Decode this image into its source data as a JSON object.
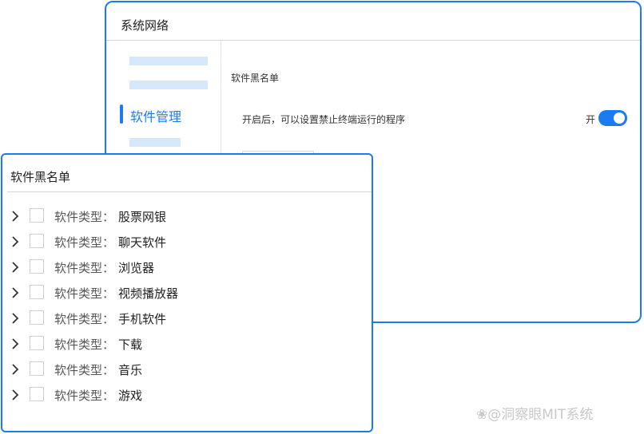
{
  "back_window": {
    "title": "系统网络",
    "sidebar_active_item": "软件管理",
    "section_title": "软件黑名单",
    "description": "开启后，可以设置禁止终端运行的程序",
    "toggle_label": "开",
    "toggle_on": true
  },
  "front_window": {
    "title": "软件黑名单",
    "rows": [
      {
        "prefix": "软件类型：",
        "value": "股票网银"
      },
      {
        "prefix": "软件类型：",
        "value": "聊天软件"
      },
      {
        "prefix": "软件类型：",
        "value": "浏览器"
      },
      {
        "prefix": "软件类型：",
        "value": "视频播放器"
      },
      {
        "prefix": "软件类型：",
        "value": "手机软件"
      },
      {
        "prefix": "软件类型：",
        "value": "下载"
      },
      {
        "prefix": "软件类型：",
        "value": "音乐"
      },
      {
        "prefix": "软件类型：",
        "value": "游戏"
      }
    ]
  },
  "watermark": "@洞察眼MIT系统",
  "colors": {
    "accent": "#1a7cf0",
    "placeholder": "#d6e8fb",
    "border": "#d6d6d6"
  },
  "icons": {
    "row_expand": "chevron-right-icon",
    "watermark_logo": "paw-icon"
  }
}
